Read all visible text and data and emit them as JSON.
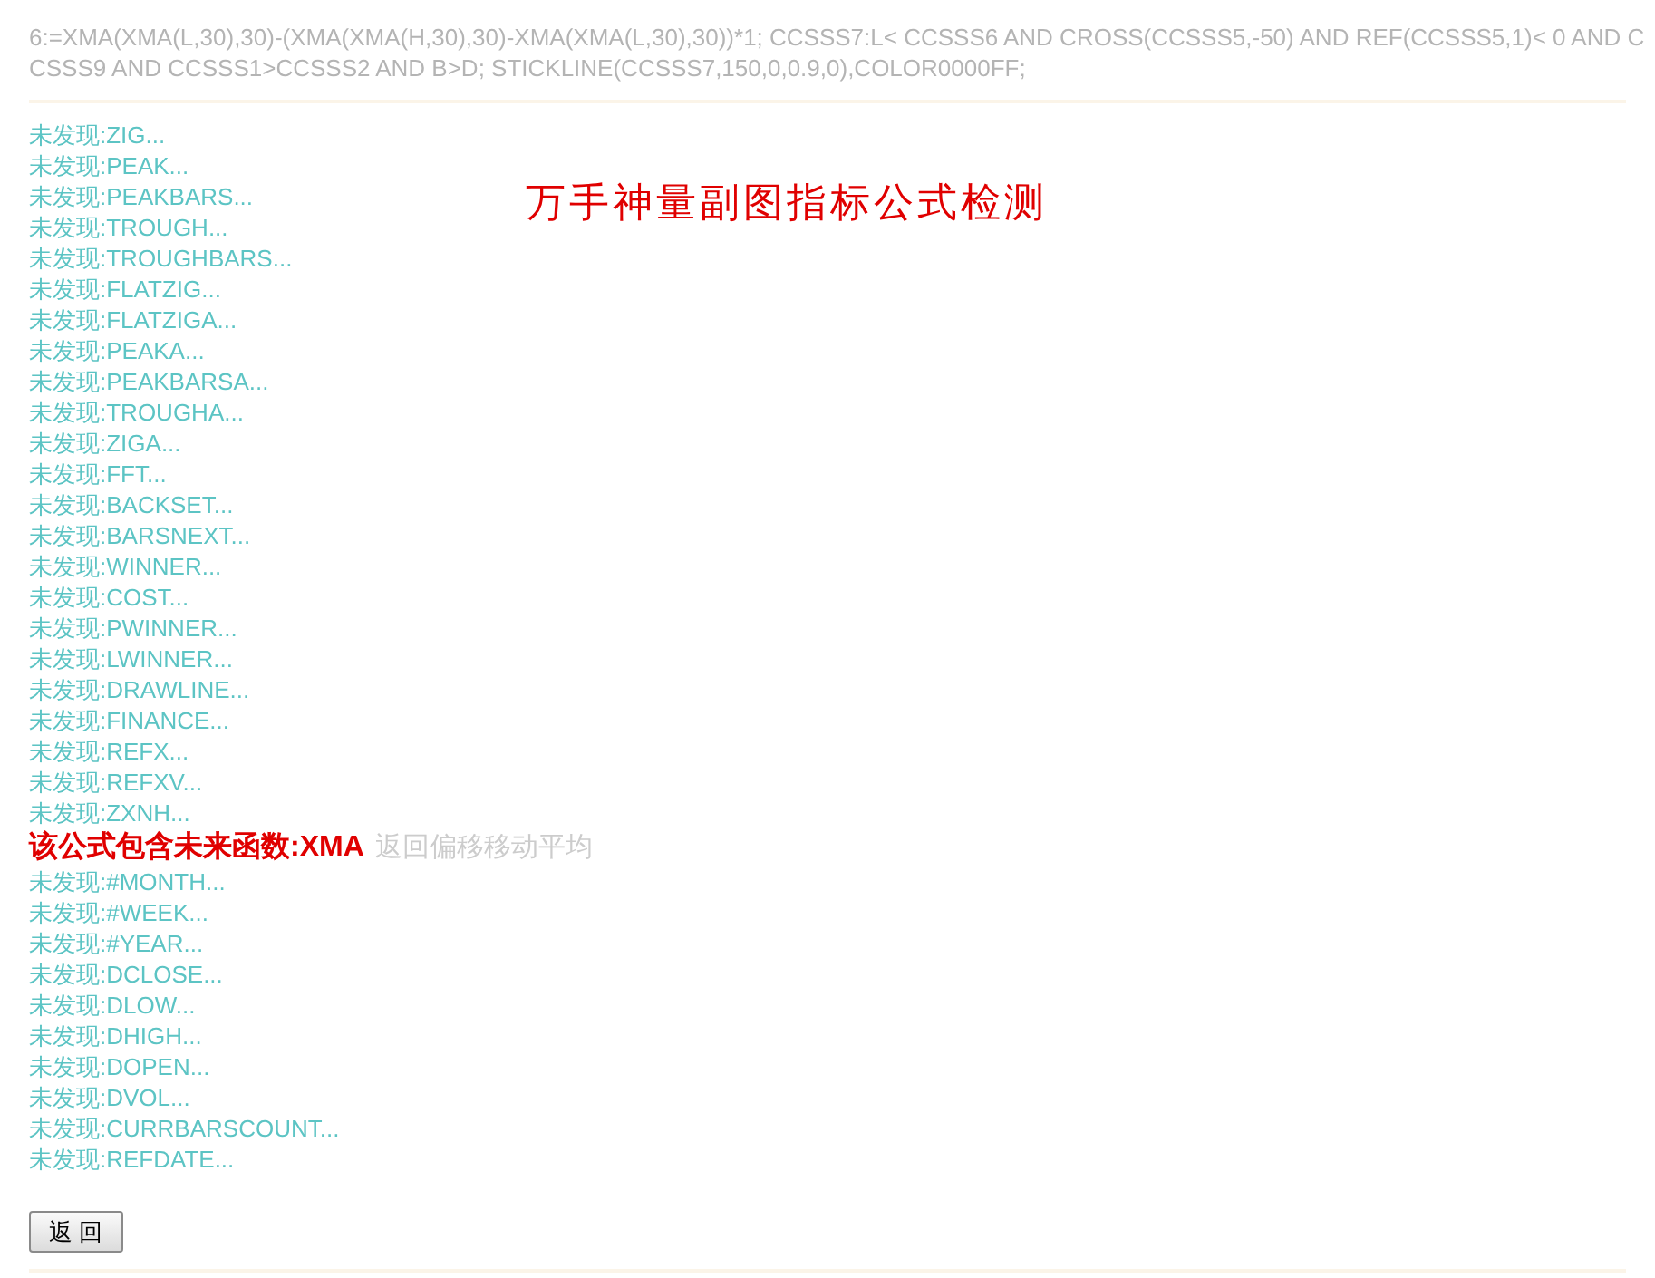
{
  "formula_lines": [
    "6:=XMA(XMA(L,30),30)-(XMA(XMA(H,30),30)-XMA(XMA(L,30),30))*1; CCSSS7:L< CCSSS6 AND CROSS(CCSSS5,-50) AND REF(CCSSS5,1)< 0 AND C",
    "CSSS9 AND CCSSS1>CCSSS2 AND B>D; STICKLINE(CCSSS7,150,0,0.9,0),COLOR0000FF;"
  ],
  "title": "万手神量副图指标公式检测",
  "results": [
    {
      "kind": "missing",
      "text": "未发现:ZIG..."
    },
    {
      "kind": "missing",
      "text": "未发现:PEAK..."
    },
    {
      "kind": "missing",
      "text": "未发现:PEAKBARS..."
    },
    {
      "kind": "missing",
      "text": "未发现:TROUGH..."
    },
    {
      "kind": "missing",
      "text": "未发现:TROUGHBARS..."
    },
    {
      "kind": "missing",
      "text": "未发现:FLATZIG..."
    },
    {
      "kind": "missing",
      "text": "未发现:FLATZIGA..."
    },
    {
      "kind": "missing",
      "text": "未发现:PEAKA..."
    },
    {
      "kind": "missing",
      "text": "未发现:PEAKBARSA..."
    },
    {
      "kind": "missing",
      "text": "未发现:TROUGHA..."
    },
    {
      "kind": "missing",
      "text": "未发现:ZIGA..."
    },
    {
      "kind": "missing",
      "text": "未发现:FFT..."
    },
    {
      "kind": "missing",
      "text": "未发现:BACKSET..."
    },
    {
      "kind": "missing",
      "text": "未发现:BARSNEXT..."
    },
    {
      "kind": "missing",
      "text": "未发现:WINNER..."
    },
    {
      "kind": "missing",
      "text": "未发现:COST..."
    },
    {
      "kind": "missing",
      "text": "未发现:PWINNER..."
    },
    {
      "kind": "missing",
      "text": "未发现:LWINNER..."
    },
    {
      "kind": "missing",
      "text": "未发现:DRAWLINE..."
    },
    {
      "kind": "missing",
      "text": "未发现:FINANCE..."
    },
    {
      "kind": "missing",
      "text": "未发现:REFX..."
    },
    {
      "kind": "missing",
      "text": "未发现:REFXV..."
    },
    {
      "kind": "missing",
      "text": "未发现:ZXNH..."
    },
    {
      "kind": "future",
      "text": "该公式包含未来函数:XMA",
      "note": "返回偏移移动平均"
    },
    {
      "kind": "missing",
      "text": "未发现:#MONTH..."
    },
    {
      "kind": "missing",
      "text": "未发现:#WEEK..."
    },
    {
      "kind": "missing",
      "text": "未发现:#YEAR..."
    },
    {
      "kind": "missing",
      "text": "未发现:DCLOSE..."
    },
    {
      "kind": "missing",
      "text": "未发现:DLOW..."
    },
    {
      "kind": "missing",
      "text": "未发现:DHIGH..."
    },
    {
      "kind": "missing",
      "text": "未发现:DOPEN..."
    },
    {
      "kind": "missing",
      "text": "未发现:DVOL..."
    },
    {
      "kind": "missing",
      "text": "未发现:CURRBARSCOUNT..."
    },
    {
      "kind": "missing",
      "text": "未发现:REFDATE..."
    }
  ],
  "back_button": "返 回"
}
